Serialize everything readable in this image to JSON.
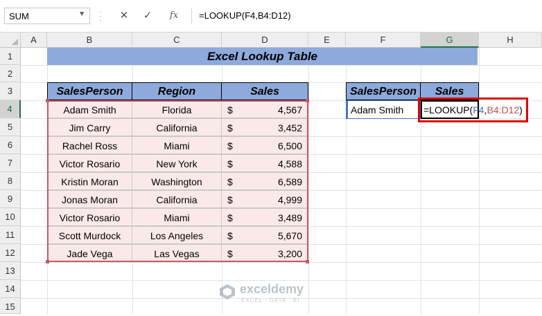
{
  "formula_bar": {
    "name_box": "SUM",
    "cancel_glyph": "✕",
    "enter_glyph": "✓",
    "fx_label": "fx",
    "formula": "=LOOKUP(F4,B4:D12)"
  },
  "columns": [
    "A",
    "B",
    "C",
    "D",
    "E",
    "F",
    "G",
    "H"
  ],
  "rows": [
    "1",
    "2",
    "3",
    "4",
    "5",
    "6",
    "7",
    "8",
    "9",
    "10",
    "11",
    "12",
    "13",
    "14",
    "15"
  ],
  "sheet": {
    "title": "Excel Lookup Table",
    "headers": [
      "SalesPerson",
      "Region",
      "Sales"
    ],
    "currency_symbol": "$",
    "records": [
      {
        "person": "Adam Smith",
        "region": "Florida",
        "sales": "4,567"
      },
      {
        "person": "Jim Carry",
        "region": "California",
        "sales": "3,452"
      },
      {
        "person": "Rachel Ross",
        "region": "Miami",
        "sales": "6,500"
      },
      {
        "person": "Victor Rosario",
        "region": "New York",
        "sales": "4,588"
      },
      {
        "person": "Kristin Moran",
        "region": "Washington",
        "sales": "6,589"
      },
      {
        "person": "Jonas Moran",
        "region": "California",
        "sales": "4,999"
      },
      {
        "person": "Victor Rosario",
        "region": "Miami",
        "sales": "3,489"
      },
      {
        "person": "Scott Murdock",
        "region": "Los Angeles",
        "sales": "5,670"
      },
      {
        "person": "Jade Vega",
        "region": "Las Vegas",
        "sales": "3,200"
      }
    ]
  },
  "lookup": {
    "headers": [
      "SalesPerson",
      "Sales"
    ],
    "person": "Adam Smith",
    "formula_prefix": "=LOOKUP(",
    "ref_lookup": "F4",
    "comma": ",",
    "ref_range": "B4:D12",
    "formula_suffix": ")"
  },
  "watermark": {
    "name": "exceldemy",
    "tagline": "EXCEL · DATA · BI"
  },
  "colors": {
    "header_fill": "#8ea9db",
    "data_fill": "#fbe9e9",
    "range_border": "#c55a68",
    "highlight": "#e00000",
    "selected_header": "#217346"
  }
}
